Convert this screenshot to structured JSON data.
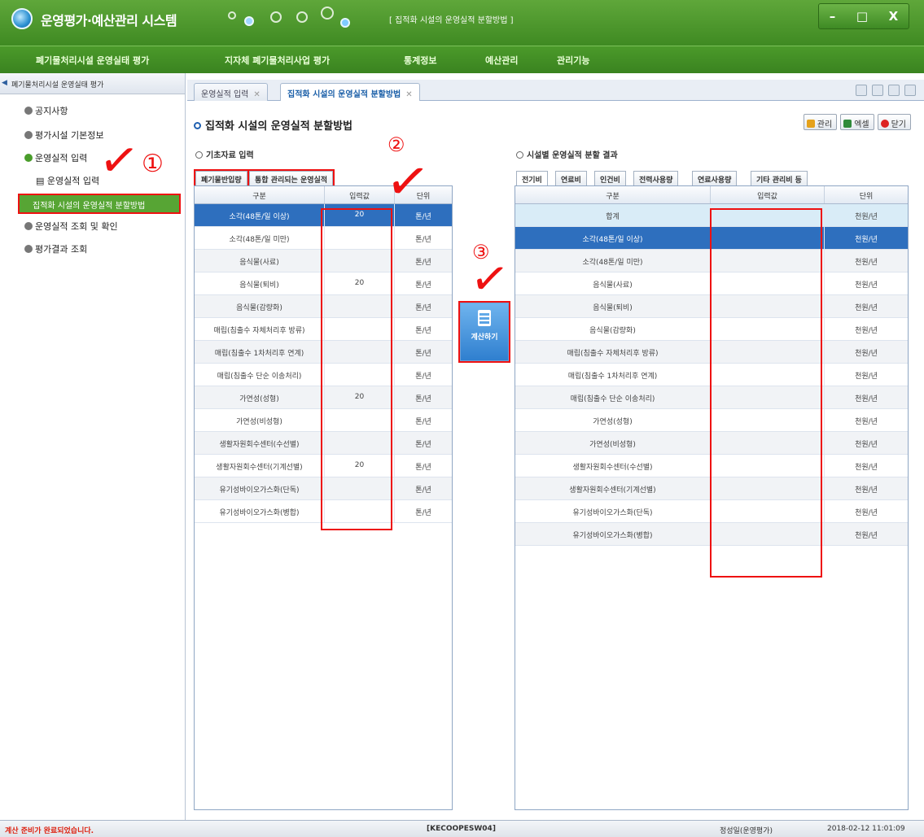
{
  "window": {
    "title": "운영평가·예산관리 시스템",
    "subtitle": "[ 집적화 시설의 운영실적 분할방법 ]",
    "controls": [
      "–",
      "□",
      "X"
    ]
  },
  "mainmenu": [
    "폐기물처리시설 운영실태 평가",
    "지자체 폐기물처리사업 평가",
    "통계정보",
    "예산관리",
    "관리기능"
  ],
  "leftbar": {
    "header": "폐기물처리시설 운영실태 평가",
    "items": [
      "공지사항",
      "평가시설 기본정보",
      "운영실적 입력",
      "운영실적 입력",
      "집적화 시설의 운영실적 분할방법",
      "운영실적 조회 및 확인",
      "평가결과 조회"
    ]
  },
  "tabs": [
    {
      "label": "운영실적 입력",
      "active": false
    },
    {
      "label": "집적화 시설의 운영실적 분할방법",
      "active": true
    }
  ],
  "page_title": "집적화 시설의 운영실적 분할방법",
  "toolbar": {
    "manage": "관리",
    "excel": "엑셀",
    "close": "닫기"
  },
  "left_section": {
    "title": "기초자료 입력",
    "subtabs": [
      "폐기물반입량",
      "통합 관리되는 운영실적"
    ],
    "headers": [
      "구분",
      "입력값",
      "단위"
    ],
    "rows": [
      {
        "name": "소각(48톤/일 이상)",
        "value": "20",
        "unit": "톤/년"
      },
      {
        "name": "소각(48톤/일 미만)",
        "value": "",
        "unit": "톤/년"
      },
      {
        "name": "음식물(사료)",
        "value": "",
        "unit": "톤/년"
      },
      {
        "name": "음식물(퇴비)",
        "value": "20",
        "unit": "톤/년"
      },
      {
        "name": "음식물(감량화)",
        "value": "",
        "unit": "톤/년"
      },
      {
        "name": "매립(침출수 자체처리후 방류)",
        "value": "",
        "unit": "톤/년"
      },
      {
        "name": "매립(침출수 1차처리후 연계)",
        "value": "",
        "unit": "톤/년"
      },
      {
        "name": "매립(침출수 단순 이송처리)",
        "value": "",
        "unit": "톤/년"
      },
      {
        "name": "가연성(성형)",
        "value": "20",
        "unit": "톤/년"
      },
      {
        "name": "가연성(비성형)",
        "value": "",
        "unit": "톤/년"
      },
      {
        "name": "생활자원회수센터(수선별)",
        "value": "",
        "unit": "톤/년"
      },
      {
        "name": "생활자원회수센터(기계선별)",
        "value": "20",
        "unit": "톤/년"
      },
      {
        "name": "유기성바이오가스화(단독)",
        "value": "",
        "unit": "톤/년"
      },
      {
        "name": "유기성바이오가스화(병합)",
        "value": "",
        "unit": "톤/년"
      }
    ]
  },
  "calc_button": "계산하기",
  "right_section": {
    "title": "시설별 운영실적 분할 결과",
    "subtabs": [
      "전기비",
      "연료비",
      "인건비",
      "전력사용량",
      "연료사용량",
      "기타 관리비 등"
    ],
    "headers": [
      "구분",
      "입력값",
      "단위"
    ],
    "rows": [
      {
        "name": "합계",
        "value": "",
        "unit": "천원/년"
      },
      {
        "name": "소각(48톤/일 이상)",
        "value": "",
        "unit": "천원/년"
      },
      {
        "name": "소각(48톤/일 미만)",
        "value": "",
        "unit": "천원/년"
      },
      {
        "name": "음식물(사료)",
        "value": "",
        "unit": "천원/년"
      },
      {
        "name": "음식물(퇴비)",
        "value": "",
        "unit": "천원/년"
      },
      {
        "name": "음식물(감량화)",
        "value": "",
        "unit": "천원/년"
      },
      {
        "name": "매립(침출수 자체처리후 방류)",
        "value": "",
        "unit": "천원/년"
      },
      {
        "name": "매립(침출수 1차처리후 연계)",
        "value": "",
        "unit": "천원/년"
      },
      {
        "name": "매립(침출수 단순 이송처리)",
        "value": "",
        "unit": "천원/년"
      },
      {
        "name": "가연성(성형)",
        "value": "",
        "unit": "천원/년"
      },
      {
        "name": "가연성(비성형)",
        "value": "",
        "unit": "천원/년"
      },
      {
        "name": "생활자원회수센터(수선별)",
        "value": "",
        "unit": "천원/년"
      },
      {
        "name": "생활자원회수센터(기계선별)",
        "value": "",
        "unit": "천원/년"
      },
      {
        "name": "유기성바이오가스화(단독)",
        "value": "",
        "unit": "천원/년"
      },
      {
        "name": "유기성바이오가스화(병합)",
        "value": "",
        "unit": "천원/년"
      }
    ]
  },
  "annotations": [
    "①",
    "②",
    "③"
  ],
  "status": {
    "message": "계산 준비가 완료되었습니다.",
    "terminal": "[KECOOPESW04]",
    "user": "정성일(운영평가)",
    "datetime": "2018-02-12 11:01:09"
  },
  "colors": {
    "accent_green": "#4b9a2a",
    "selected_blue": "#2e6fbe",
    "annotation_red": "#e11111"
  }
}
